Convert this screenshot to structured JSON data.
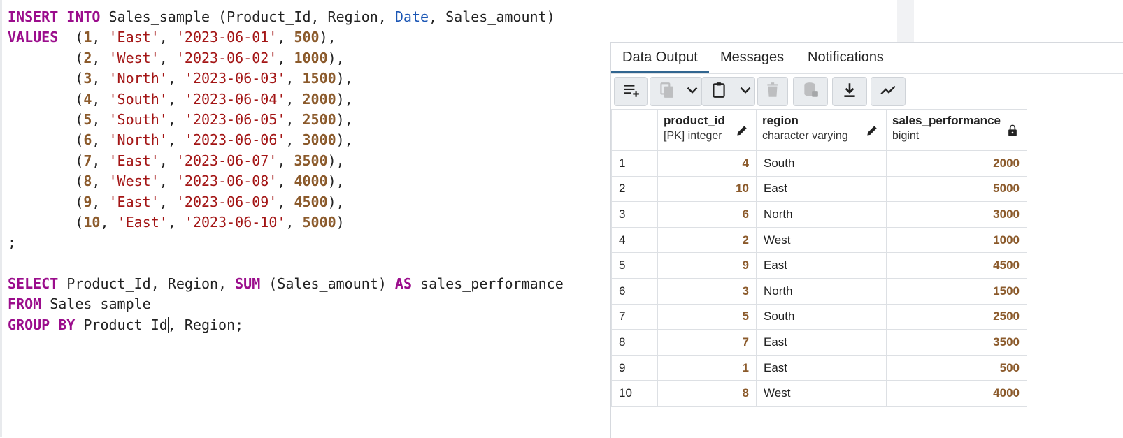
{
  "editor": {
    "lines": [
      [
        {
          "t": "INSERT INTO",
          "c": "kw"
        },
        {
          "t": " Sales_sample (Product_Id, Region, "
        },
        {
          "t": "Date",
          "c": "fn"
        },
        {
          "t": ", Sales_amount)"
        }
      ],
      [
        {
          "t": "VALUES",
          "c": "kw"
        },
        {
          "t": "  ("
        },
        {
          "t": "1",
          "c": "num"
        },
        {
          "t": ", "
        },
        {
          "t": "'East'",
          "c": "str"
        },
        {
          "t": ", "
        },
        {
          "t": "'2023-06-01'",
          "c": "str"
        },
        {
          "t": ", "
        },
        {
          "t": "500",
          "c": "num"
        },
        {
          "t": "),"
        }
      ],
      [
        {
          "t": "        ("
        },
        {
          "t": "2",
          "c": "num"
        },
        {
          "t": ", "
        },
        {
          "t": "'West'",
          "c": "str"
        },
        {
          "t": ", "
        },
        {
          "t": "'2023-06-02'",
          "c": "str"
        },
        {
          "t": ", "
        },
        {
          "t": "1000",
          "c": "num"
        },
        {
          "t": "),"
        }
      ],
      [
        {
          "t": "        ("
        },
        {
          "t": "3",
          "c": "num"
        },
        {
          "t": ", "
        },
        {
          "t": "'North'",
          "c": "str"
        },
        {
          "t": ", "
        },
        {
          "t": "'2023-06-03'",
          "c": "str"
        },
        {
          "t": ", "
        },
        {
          "t": "1500",
          "c": "num"
        },
        {
          "t": "),"
        }
      ],
      [
        {
          "t": "        ("
        },
        {
          "t": "4",
          "c": "num"
        },
        {
          "t": ", "
        },
        {
          "t": "'South'",
          "c": "str"
        },
        {
          "t": ", "
        },
        {
          "t": "'2023-06-04'",
          "c": "str"
        },
        {
          "t": ", "
        },
        {
          "t": "2000",
          "c": "num"
        },
        {
          "t": "),"
        }
      ],
      [
        {
          "t": "        ("
        },
        {
          "t": "5",
          "c": "num"
        },
        {
          "t": ", "
        },
        {
          "t": "'South'",
          "c": "str"
        },
        {
          "t": ", "
        },
        {
          "t": "'2023-06-05'",
          "c": "str"
        },
        {
          "t": ", "
        },
        {
          "t": "2500",
          "c": "num"
        },
        {
          "t": "),"
        }
      ],
      [
        {
          "t": "        ("
        },
        {
          "t": "6",
          "c": "num"
        },
        {
          "t": ", "
        },
        {
          "t": "'North'",
          "c": "str"
        },
        {
          "t": ", "
        },
        {
          "t": "'2023-06-06'",
          "c": "str"
        },
        {
          "t": ", "
        },
        {
          "t": "3000",
          "c": "num"
        },
        {
          "t": "),"
        }
      ],
      [
        {
          "t": "        ("
        },
        {
          "t": "7",
          "c": "num"
        },
        {
          "t": ", "
        },
        {
          "t": "'East'",
          "c": "str"
        },
        {
          "t": ", "
        },
        {
          "t": "'2023-06-07'",
          "c": "str"
        },
        {
          "t": ", "
        },
        {
          "t": "3500",
          "c": "num"
        },
        {
          "t": "),"
        }
      ],
      [
        {
          "t": "        ("
        },
        {
          "t": "8",
          "c": "num"
        },
        {
          "t": ", "
        },
        {
          "t": "'West'",
          "c": "str"
        },
        {
          "t": ", "
        },
        {
          "t": "'2023-06-08'",
          "c": "str"
        },
        {
          "t": ", "
        },
        {
          "t": "4000",
          "c": "num"
        },
        {
          "t": "),"
        }
      ],
      [
        {
          "t": "        ("
        },
        {
          "t": "9",
          "c": "num"
        },
        {
          "t": ", "
        },
        {
          "t": "'East'",
          "c": "str"
        },
        {
          "t": ", "
        },
        {
          "t": "'2023-06-09'",
          "c": "str"
        },
        {
          "t": ", "
        },
        {
          "t": "4500",
          "c": "num"
        },
        {
          "t": "),"
        }
      ],
      [
        {
          "t": "        ("
        },
        {
          "t": "10",
          "c": "num"
        },
        {
          "t": ", "
        },
        {
          "t": "'East'",
          "c": "str"
        },
        {
          "t": ", "
        },
        {
          "t": "'2023-06-10'",
          "c": "str"
        },
        {
          "t": ", "
        },
        {
          "t": "5000",
          "c": "num"
        },
        {
          "t": ")"
        }
      ],
      [
        {
          "t": ";"
        }
      ],
      [],
      [
        {
          "t": "SELECT",
          "c": "kw"
        },
        {
          "t": " Product_Id, Region, "
        },
        {
          "t": "SUM",
          "c": "kw"
        },
        {
          "t": " (Sales_amount) "
        },
        {
          "t": "AS",
          "c": "kw"
        },
        {
          "t": " sales_performance"
        }
      ],
      [
        {
          "t": "FROM",
          "c": "kw"
        },
        {
          "t": " Sales_sample"
        }
      ],
      [
        {
          "t": "GROUP BY",
          "c": "kw"
        },
        {
          "t": " Product_Id"
        },
        {
          "t": "",
          "cursor": true
        },
        {
          "t": ", Region;"
        }
      ]
    ]
  },
  "results": {
    "tabs": [
      {
        "label": "Data Output",
        "active": true
      },
      {
        "label": "Messages",
        "active": false
      },
      {
        "label": "Notifications",
        "active": false
      }
    ],
    "toolbar": [
      {
        "name": "add-row-button",
        "icon": "add-row-icon"
      },
      {
        "name": "copy-button",
        "icon": "copy-icon"
      },
      {
        "name": "copy-options-dropdown",
        "icon": "chevron-down-icon"
      },
      {
        "name": "paste-button",
        "icon": "paste-icon"
      },
      {
        "name": "paste-options-dropdown",
        "icon": "chevron-down-icon"
      },
      {
        "name": "delete-button",
        "icon": "trash-icon"
      },
      {
        "name": "save-data-button",
        "icon": "database-save-icon"
      },
      {
        "name": "download-button",
        "icon": "download-icon"
      },
      {
        "name": "graph-visualiser-button",
        "icon": "line-graph-icon"
      }
    ],
    "columns": [
      {
        "name": "product_id",
        "type": "[PK] integer",
        "icon": "pencil-icon",
        "align": "right"
      },
      {
        "name": "region",
        "type": "character varying",
        "icon": "pencil-icon",
        "align": "left"
      },
      {
        "name": "sales_performance",
        "type": "bigint",
        "icon": "lock-icon",
        "align": "right"
      }
    ],
    "rows": [
      {
        "n": "1",
        "cells": [
          "4",
          "South",
          "2000"
        ]
      },
      {
        "n": "2",
        "cells": [
          "10",
          "East",
          "5000"
        ]
      },
      {
        "n": "3",
        "cells": [
          "6",
          "North",
          "3000"
        ]
      },
      {
        "n": "4",
        "cells": [
          "2",
          "West",
          "1000"
        ]
      },
      {
        "n": "5",
        "cells": [
          "9",
          "East",
          "4500"
        ]
      },
      {
        "n": "6",
        "cells": [
          "3",
          "North",
          "1500"
        ]
      },
      {
        "n": "7",
        "cells": [
          "5",
          "South",
          "2500"
        ]
      },
      {
        "n": "8",
        "cells": [
          "7",
          "East",
          "3500"
        ]
      },
      {
        "n": "9",
        "cells": [
          "1",
          "East",
          "500"
        ]
      },
      {
        "n": "10",
        "cells": [
          "8",
          "West",
          "4000"
        ]
      }
    ]
  }
}
